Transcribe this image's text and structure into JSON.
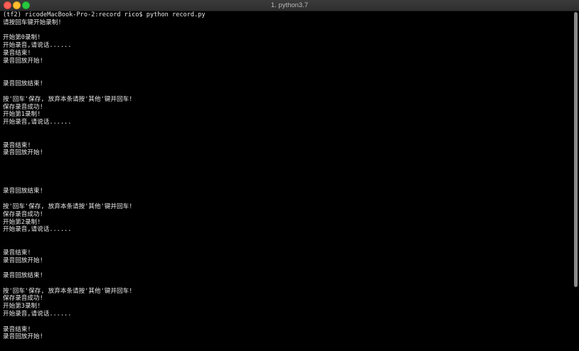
{
  "window": {
    "title": "1. python3.7"
  },
  "terminal": {
    "lines": [
      "(tf2) ricodeMacBook-Pro-2:record rico$ python record.py",
      "请按回车键开始录制!",
      "",
      "开始第0录制!",
      "开始录音,请说话......",
      "录音结束!",
      "录音回放开始!",
      "",
      "",
      "录音回放结束!",
      "",
      "按'回车'保存, 放弃本条请按'其他'键并回车!",
      "保存录音成功!",
      "开始第1录制!",
      "开始录音,请说话......",
      "",
      "",
      "录音结束!",
      "录音回放开始!",
      "",
      "",
      "",
      "",
      "录音回放结束!",
      "",
      "按'回车'保存, 放弃本条请按'其他'键并回车!",
      "保存录音成功!",
      "开始第2录制!",
      "开始录音,请说话......",
      "",
      "",
      "录音结束!",
      "录音回放开始!",
      "",
      "录音回放结束!",
      "",
      "按'回车'保存, 放弃本条请按'其他'键并回车!",
      "保存录音成功!",
      "开始第3录制!",
      "开始录音,请说话......",
      "",
      "录音结束!",
      "录音回放开始!"
    ]
  },
  "colors": {
    "background": "#000000",
    "text": "#e8e8e8",
    "titlebar": "#333333",
    "close": "#fc5f57",
    "minimize": "#fdbc2e",
    "maximize": "#28c840"
  }
}
